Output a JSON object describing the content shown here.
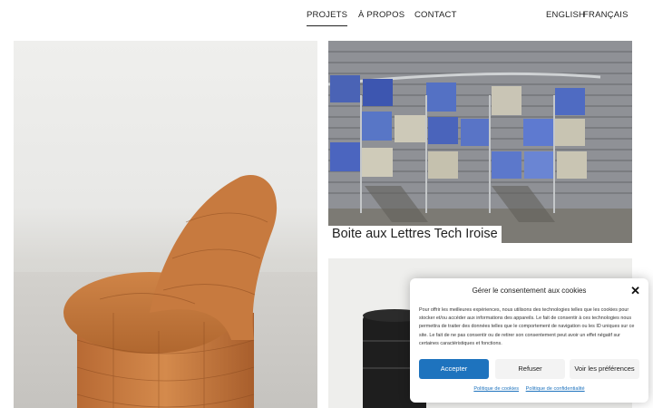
{
  "nav": {
    "projets": "PROJETS",
    "apropos": "À PROPOS",
    "contact": "CONTACT",
    "english": "ENGLISH",
    "francais": "FRANÇAIS"
  },
  "projects": {
    "mailbox_caption": "Boite aux Lettres Tech Iroise"
  },
  "cookie": {
    "title": "Gérer le consentement aux cookies",
    "body": "Pour offrir les meilleures expériences, nous utilisons des technologies telles que les cookies pour stocker et/ou accéder aux informations des appareils. Le fait de consentir à ces technologies nous permettra de traiter des données telles que le comportement de navigation ou les ID uniques sur ce site. Le fait de ne pas consentir ou de retirer son consentement peut avoir un effet négatif sur certaines caractéristiques et fonctions.",
    "accept": "Accepter",
    "refuse": "Refuser",
    "prefs": "Voir les préférences",
    "cookie_policy": "Politique de cookies",
    "privacy_policy": "Politique de confidentialité",
    "close_icon": "✕"
  },
  "colors": {
    "accent": "#1e73be",
    "wood": "#c97a40"
  }
}
